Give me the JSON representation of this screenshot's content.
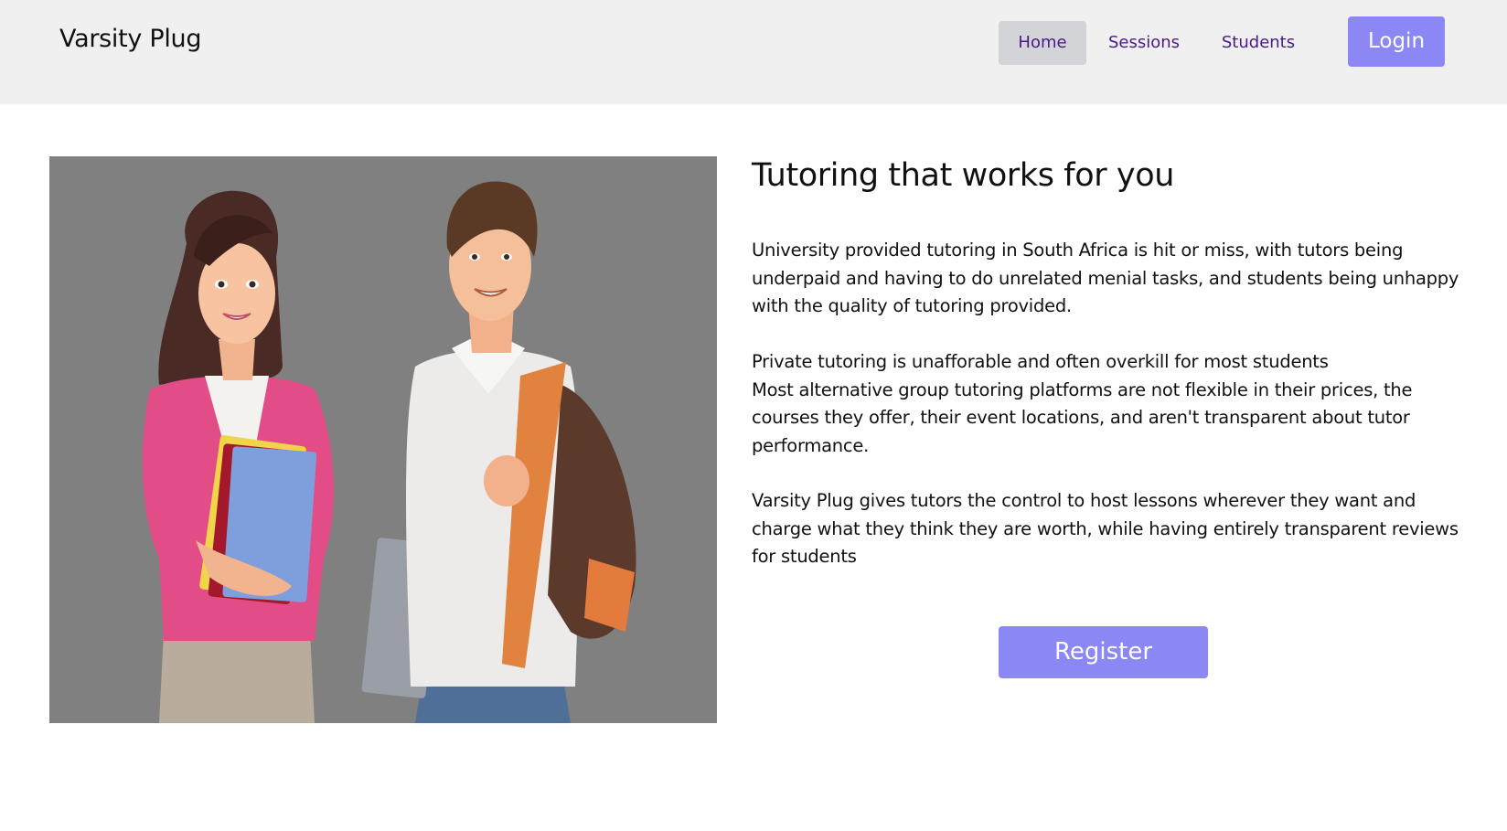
{
  "header": {
    "brand": "Varsity Plug",
    "nav": [
      {
        "label": "Home",
        "active": true
      },
      {
        "label": "Sessions",
        "active": false
      },
      {
        "label": "Students",
        "active": false
      }
    ],
    "login_label": "Login"
  },
  "hero": {
    "image_description_icon": "students-illustration",
    "title": "Tutoring that works for you",
    "paragraph1": "University provided tutoring in South Africa is hit or miss, with tutors being underpaid and having to do unrelated menial tasks, and students being unhappy with the quality of tutoring provided.",
    "paragraph2_line1": "Private tutoring is unafforable and often overkill for most students",
    "paragraph2_line2": "Most alternative group tutoring platforms are not flexible in their prices, the courses they offer, their event locations, and aren't transparent about tutor performance.",
    "paragraph3": "Varsity Plug gives tutors the control to host lessons wherever they want and charge what they think they are worth, while having entirely transparent reviews for students",
    "register_label": "Register"
  },
  "colors": {
    "navbar_bg": "#f0f0f0",
    "accent": "#8b87f5",
    "nav_link": "#4b1a8a",
    "nav_active_bg": "#d2d4d8",
    "image_bg": "#808080"
  }
}
